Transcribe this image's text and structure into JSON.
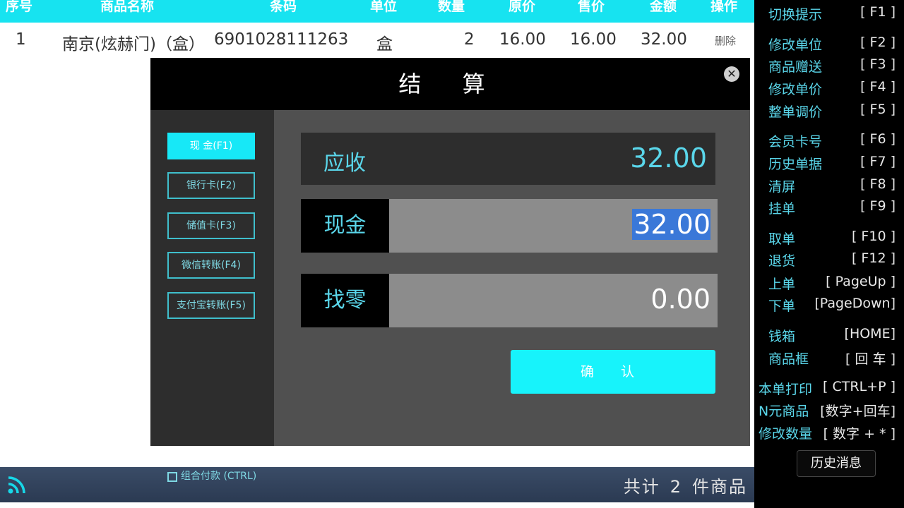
{
  "table": {
    "headers": [
      "序号",
      "商品名称",
      "条码",
      "单位",
      "数量",
      "原价",
      "售价",
      "金额",
      "操作"
    ],
    "rows": [
      {
        "index": "1",
        "name": "南京(炫赫门)（盒）",
        "barcode": "6901028111263",
        "unit": "盒",
        "qty": "2",
        "orig_price": "16.00",
        "price": "16.00",
        "amount": "32.00",
        "action": "删除"
      }
    ]
  },
  "footer": {
    "total_prefix": "共计",
    "total_count": "2",
    "total_suffix": "件商品"
  },
  "sidebar": {
    "shortcuts": [
      {
        "label": "切换提示",
        "key": "[ F1 ]"
      },
      {
        "label": "修改单位",
        "key": "[ F2 ]"
      },
      {
        "label": "商品赠送",
        "key": "[ F3 ]"
      },
      {
        "label": "修改单价",
        "key": "[ F4 ]"
      },
      {
        "label": "整单调价",
        "key": "[ F5 ]"
      },
      {
        "label": "会员卡号",
        "key": "[ F6 ]"
      },
      {
        "label": "历史单据",
        "key": "[ F7 ]"
      },
      {
        "label": "清屏",
        "key": "[ F8 ]"
      },
      {
        "label": "挂单",
        "key": "[ F9 ]"
      },
      {
        "label": "取单",
        "key": "[ F10 ]"
      },
      {
        "label": "退货",
        "key": "[ F12 ]"
      },
      {
        "label": "上单",
        "key": "[ PageUp ]"
      },
      {
        "label": "下单",
        "key": "[PageDown]"
      },
      {
        "label": "钱箱",
        "key": "[HOME]"
      },
      {
        "label": "商品框",
        "key": "[ 回 车 ]"
      },
      {
        "label": "本单打印",
        "key": "[ CTRL+P ]"
      },
      {
        "label": "N元商品",
        "key": "[数字+回车]"
      },
      {
        "label": "修改数量",
        "key": "[ 数字 + * ]"
      }
    ],
    "history_button": "历史消息"
  },
  "modal": {
    "title": "结 算",
    "close": "✕",
    "payment_methods": [
      "现 金(F1)",
      "银行卡(F2)",
      "储值卡(F3)",
      "微信转账(F4)",
      "支付宝转账(F5)"
    ],
    "active_method_index": 0,
    "combo_label": "组合付款 (CTRL)",
    "receivable_label": "应收",
    "receivable_value": "32.00",
    "cash_label": "现金",
    "cash_value": "32.00",
    "change_label": "找零",
    "change_value": "0.00",
    "confirm_label": "确 认"
  },
  "colors": {
    "accent": "#17e8f7",
    "label_cyan": "#5ad6ea",
    "selection": "#3a78d8"
  }
}
